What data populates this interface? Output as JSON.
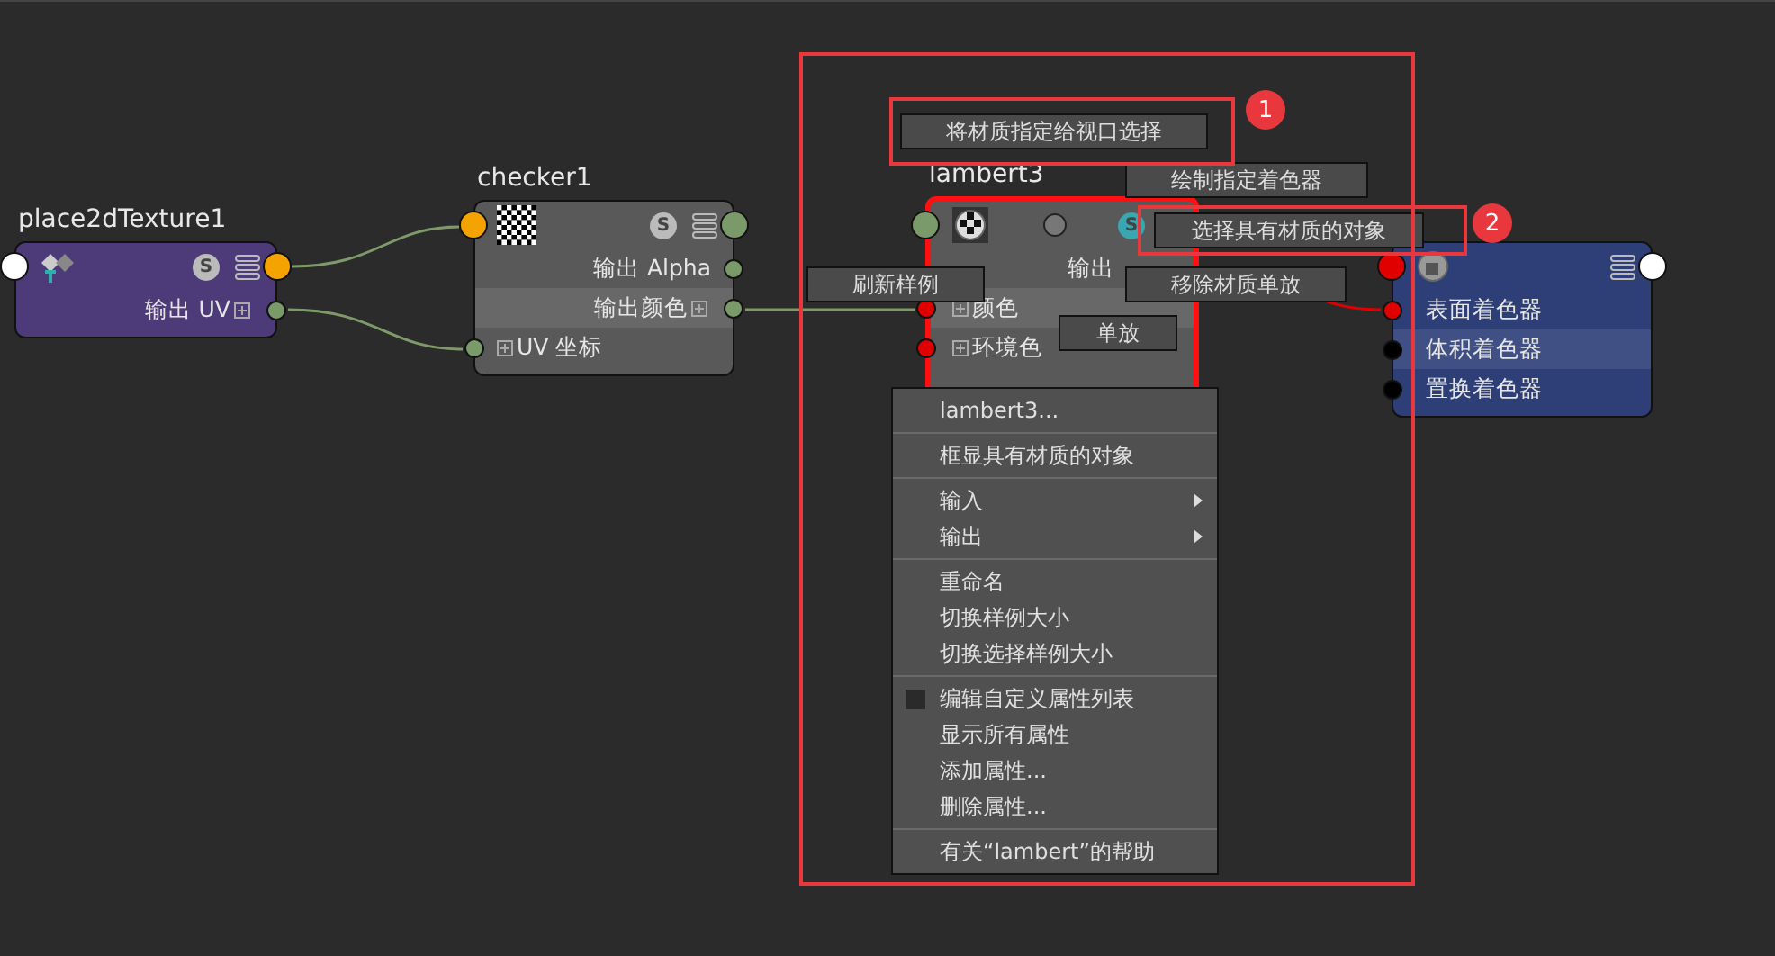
{
  "nodes": [
    {
      "kind": "place2d",
      "title": "place2dTexture1",
      "badge": "S",
      "selected": false,
      "header_ports": [
        {
          "kind": "input",
          "color": "#ffffff"
        },
        {
          "kind": "output",
          "color": "#f5a300"
        }
      ],
      "rows": [
        {
          "label": "输出 UV",
          "kind": "output",
          "color": "#7a9a6a",
          "expandable": true,
          "highlighted": false
        }
      ]
    },
    {
      "kind": "checker",
      "title": "checker1",
      "badge": "S",
      "selected": false,
      "header_ports": [
        {
          "kind": "input",
          "color": "#f5a300"
        },
        {
          "kind": "output",
          "color": "#7a9a6a"
        }
      ],
      "rows": [
        {
          "label": "输出 Alpha",
          "kind": "output",
          "color": "#7a9a6a",
          "expandable": false,
          "highlighted": false
        },
        {
          "label": "输出颜色",
          "kind": "output",
          "color": "#7a9a6a",
          "expandable": true,
          "highlighted": true
        },
        {
          "label": "UV 坐标",
          "kind": "input",
          "color": "#7a9a6a",
          "expandable": true,
          "highlighted": false
        }
      ]
    },
    {
      "kind": "lambert",
      "title": "lambert3",
      "badge": "S",
      "selected": true,
      "header_ports": [
        {
          "kind": "input",
          "color": "#7a9a6a"
        }
      ],
      "rows": [
        {
          "label": "输出",
          "kind": "output",
          "expandable": false,
          "highlighted": false
        },
        {
          "label": "颜色",
          "kind": "input",
          "color": "#e00000",
          "expandable": true,
          "highlighted": true
        },
        {
          "label": "环境色",
          "kind": "input",
          "color": "#e00000",
          "expandable": true,
          "highlighted": false
        }
      ]
    },
    {
      "kind": "shading_group",
      "selected": false,
      "header_ports": [
        {
          "kind": "input",
          "color": "#e00000"
        },
        {
          "kind": "output",
          "color": "#ffffff"
        }
      ],
      "rows": [
        {
          "label": "表面着色器",
          "kind": "input",
          "color": "#e00000",
          "expandable": false,
          "highlighted": false
        },
        {
          "label": "体积着色器",
          "kind": "input",
          "color": "#000000",
          "expandable": false,
          "highlighted": true
        },
        {
          "label": "置换着色器",
          "kind": "input",
          "color": "#000000",
          "expandable": false,
          "highlighted": false
        }
      ]
    }
  ],
  "floating_buttons": [
    "将材质指定给视口选择",
    "绘制指定着色器",
    "选择具有材质的对象",
    "刷新样例",
    "移除材质单放",
    "单放"
  ],
  "context_menu": [
    [
      {
        "label": "lambert3...",
        "kind": "item"
      }
    ],
    [
      {
        "label": "框显具有材质的对象",
        "kind": "item"
      }
    ],
    [
      {
        "label": "输入",
        "kind": "submenu"
      },
      {
        "label": "输出",
        "kind": "submenu"
      }
    ],
    [
      {
        "label": "重命名",
        "kind": "item"
      },
      {
        "label": "切换样例大小",
        "kind": "item"
      },
      {
        "label": "切换选择样例大小",
        "kind": "item"
      }
    ],
    [
      {
        "label": "编辑自定义属性列表",
        "kind": "checkbox",
        "checked": false
      },
      {
        "label": "显示所有属性",
        "kind": "item"
      },
      {
        "label": "添加属性...",
        "kind": "item"
      },
      {
        "label": "删除属性...",
        "kind": "item"
      }
    ],
    [
      {
        "label": "有关“lambert”的帮助",
        "kind": "item"
      }
    ]
  ],
  "annotations": [
    {
      "number": "1"
    },
    {
      "number": "2"
    }
  ]
}
